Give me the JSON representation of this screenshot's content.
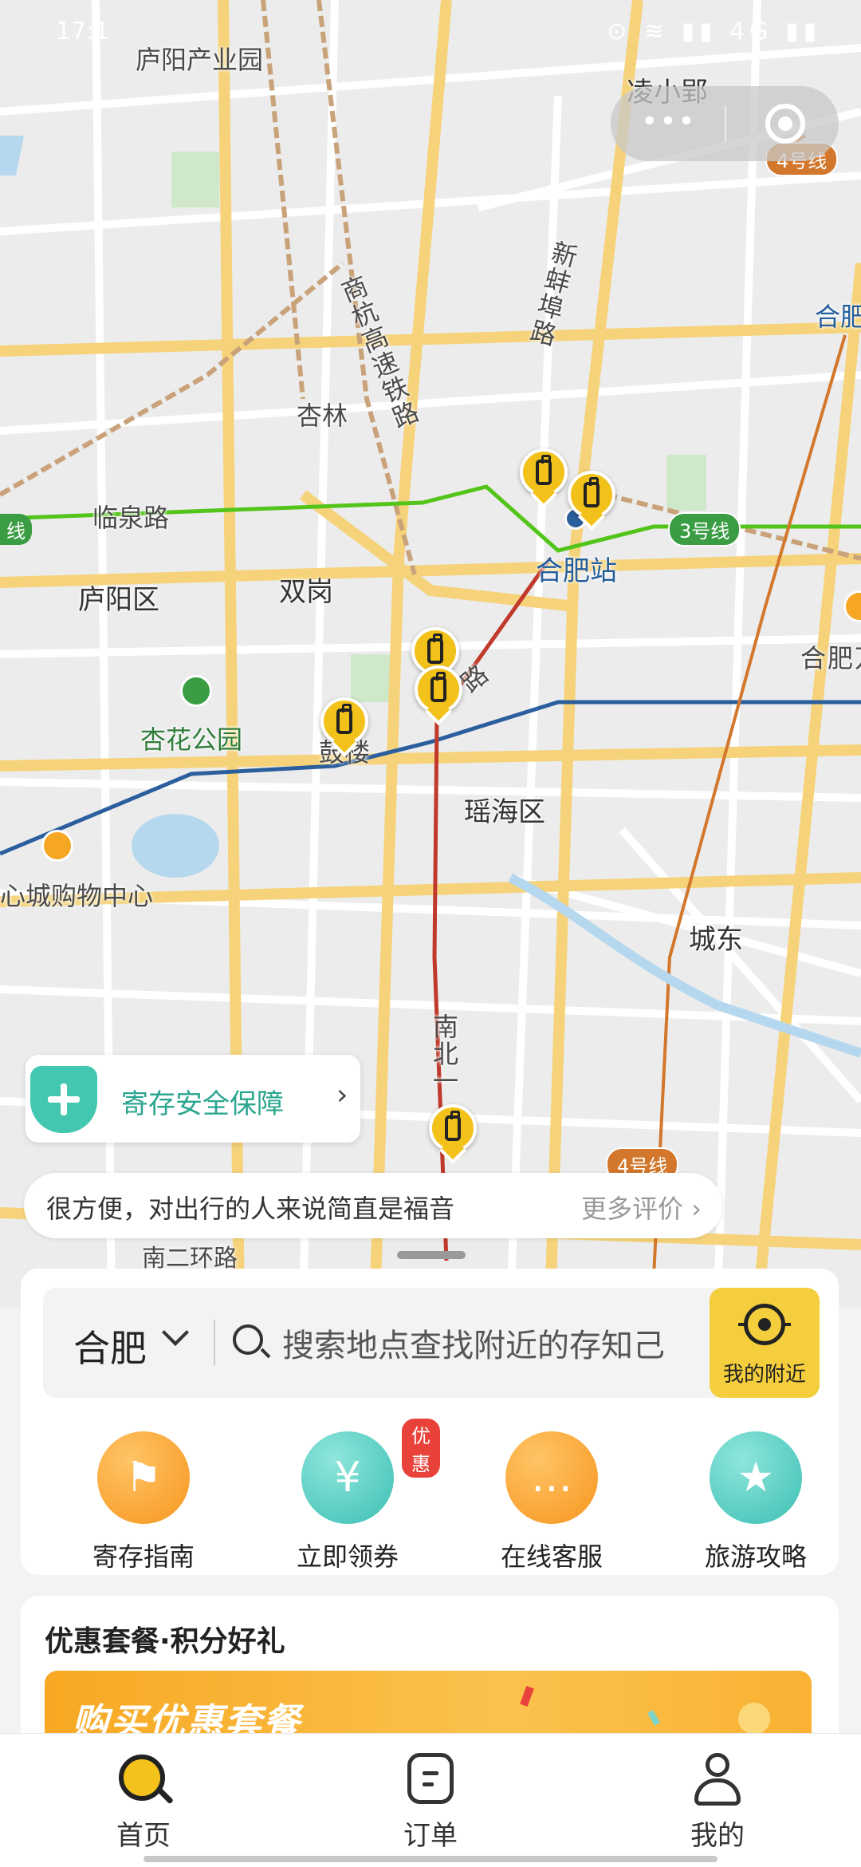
{
  "status_bar": {
    "time": "17:1",
    "icons": "⊙ ≋ ▮▮ 4G ▮▮"
  },
  "map": {
    "labels": {
      "luyang_park": "庐阳产业园",
      "lingxiaoying": "凌小郢",
      "shanghang_rail": "商杭高速铁路",
      "xinbengbu_road": "新蚌埠路",
      "hefei_right": "合肥",
      "xinglin": "杏林",
      "linquan_road": "临泉路",
      "hefei_station": "合肥站",
      "luyang_district": "庐阳区",
      "shuanggang": "双岗",
      "hefei_wanda": "合肥万达",
      "apricot_park": "杏花公园",
      "gulou": "鼓楼",
      "yaohai_district": "瑶海区",
      "mall": "心城购物中心",
      "chengdong": "城东",
      "nanbei_road": "南北一",
      "nan_erhuan": "南二环路",
      "road_lu": "路",
      "line_left": "线"
    },
    "line_badges": {
      "line4_top": "4号线",
      "line3": "3号线",
      "line4_bottom": "4号线"
    }
  },
  "capsule": {
    "more_dots": "•••"
  },
  "safety": {
    "label": "寄存安全保障",
    "chevron": "›"
  },
  "review": {
    "text": "很方便，对出行的人来说简直是福音",
    "more": "更多评价 ›"
  },
  "search": {
    "city": "合肥",
    "placeholder": "搜索地点查找附近的存知己",
    "nearby_label": "我的附近"
  },
  "quick_actions": [
    {
      "label": "寄存指南",
      "icon": "signpost-icon",
      "glyph": "⚑"
    },
    {
      "label": "立即领券",
      "icon": "coupon-icon",
      "glyph": "¥",
      "badge": "优惠"
    },
    {
      "label": "在线客服",
      "icon": "chat-icon",
      "glyph": "…"
    },
    {
      "label": "旅游攻略",
      "icon": "guidebook-icon",
      "glyph": "★"
    }
  ],
  "promo": {
    "title": "优惠套餐·积分好礼",
    "banner_text": "购买优惠套餐"
  },
  "tabs": [
    {
      "label": "首页",
      "icon": "home-search-icon"
    },
    {
      "label": "订单",
      "icon": "order-icon"
    },
    {
      "label": "我的",
      "icon": "profile-icon"
    }
  ],
  "colors": {
    "accent": "#f4ce3c",
    "teal": "#43c7b0",
    "badge_red": "#e8423a"
  }
}
